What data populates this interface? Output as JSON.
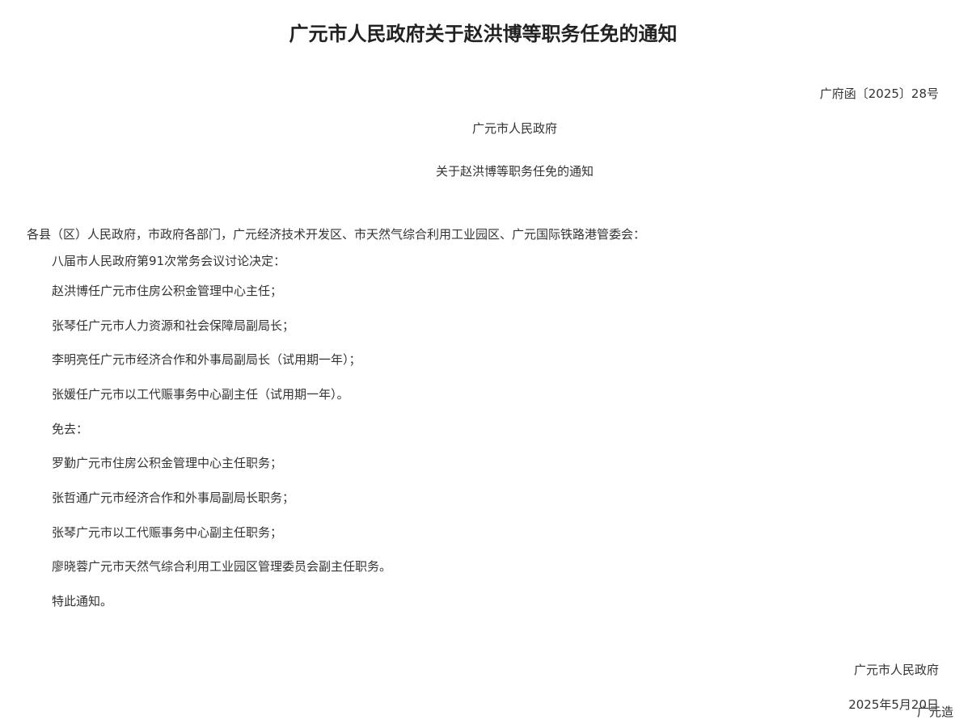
{
  "document": {
    "title": "广元市人民政府关于赵洪博等职务任免的通知",
    "number": "广府函〔2025〕28号",
    "issuer": "广元市人民政府",
    "subtitle": "关于赵洪博等职务任免的通知",
    "salutation": "各县（区）人民政府，市政府各部门，广元经济技术开发区、市天然气综合利用工业园区、广元国际铁路港管委会：",
    "paragraphs": [
      "八届市人民政府第91次常务会议讨论决定：",
      "赵洪博任广元市住房公积金管理中心主任；",
      "张琴任广元市人力资源和社会保障局副局长；",
      "李明亮任广元市经济合作和外事局副局长（试用期一年）；",
      "张媛任广元市以工代赈事务中心副主任（试用期一年）。",
      "免去：",
      "罗勤广元市住房公积金管理中心主任职务；",
      "张哲通广元市经济合作和外事局副局长职务；",
      "张琴广元市以工代赈事务中心副主任职务；",
      "廖晓蓉广元市天然气综合利用工业园区管理委员会副主任职务。",
      "特此通知。"
    ],
    "signature_org": "广元市人民政府",
    "signature_date": "2025年5月20日",
    "footer_fragment": "广元造"
  }
}
